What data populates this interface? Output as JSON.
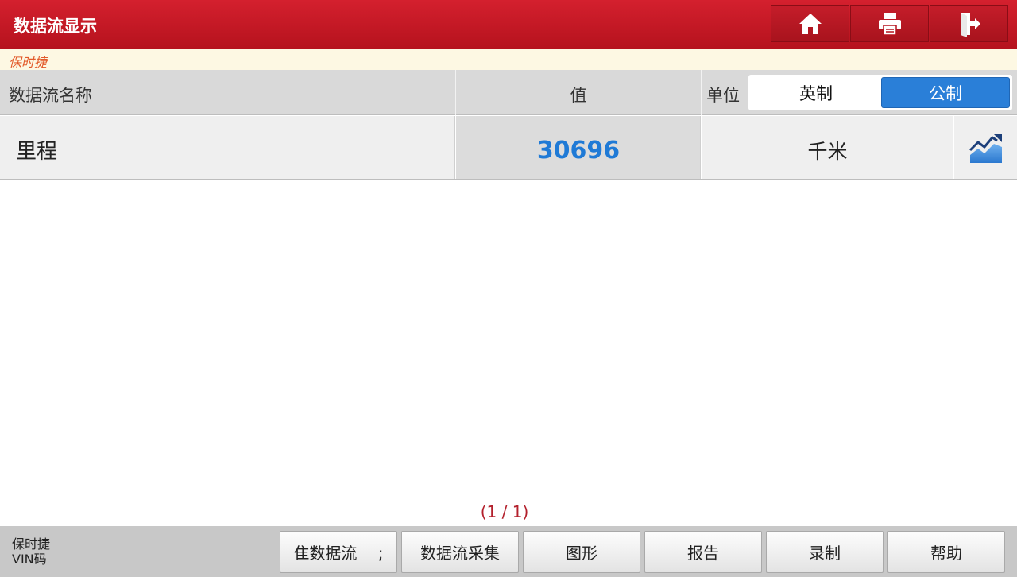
{
  "header": {
    "title": "数据流显示",
    "buttons": [
      {
        "icon": "home-icon"
      },
      {
        "icon": "print-icon"
      },
      {
        "icon": "exit-icon"
      }
    ]
  },
  "brand": "保时捷",
  "table": {
    "col_name": "数据流名称",
    "col_value": "值",
    "col_unit": "单位",
    "unit_options": {
      "imperial": "英制",
      "metric": "公制",
      "selected": "公制"
    },
    "rows": [
      {
        "name": "里程",
        "value": "30696",
        "unit": "千米"
      }
    ]
  },
  "pager": "(1 / 1)",
  "footer": {
    "vehicle": "保时捷",
    "vin_label": "VIN码",
    "buttons": [
      "隹数据流　 ;",
      "数据流采集",
      "图形",
      "报告",
      "录制",
      "帮助"
    ]
  },
  "colors": {
    "header_red": "#c8192a",
    "accent_blue": "#2a7fd8",
    "value_blue": "#1f7ad6"
  }
}
